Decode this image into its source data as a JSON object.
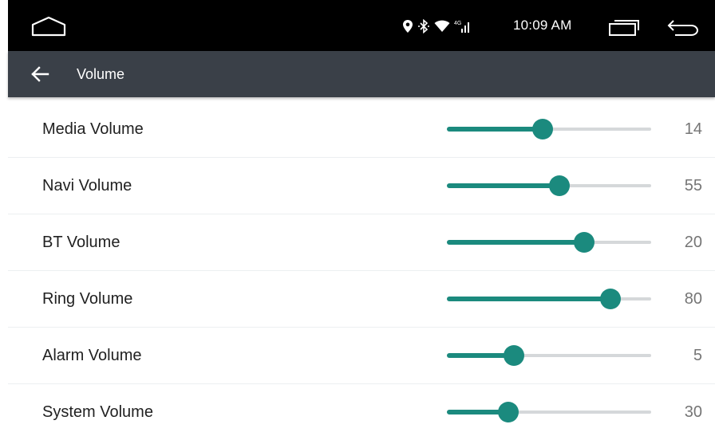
{
  "status_bar": {
    "time": "10:09 AM",
    "icons": [
      "location-icon",
      "bluetooth-icon",
      "wifi-icon",
      "4g-signal-icon"
    ],
    "nav_buttons": [
      "home-icon",
      "recents-icon",
      "back-icon"
    ]
  },
  "app_bar": {
    "title": "Volume",
    "back_icon": "arrow-back-icon"
  },
  "volumes": [
    {
      "label": "Media Volume",
      "value": "14",
      "level": 0.47
    },
    {
      "label": "Navi Volume",
      "value": "55",
      "level": 0.55
    },
    {
      "label": "BT Volume",
      "value": "20",
      "level": 0.67
    },
    {
      "label": "Ring Volume",
      "value": "80",
      "level": 0.8
    },
    {
      "label": "Alarm Volume",
      "value": "5",
      "level": 0.33
    },
    {
      "label": "System Volume",
      "value": "30",
      "level": 0.3
    }
  ],
  "colors": {
    "status_bar": "#000000",
    "app_bar": "#3a4048",
    "accent": "#1b8a7e",
    "track": "#d5d8da",
    "value_text": "#757575"
  }
}
